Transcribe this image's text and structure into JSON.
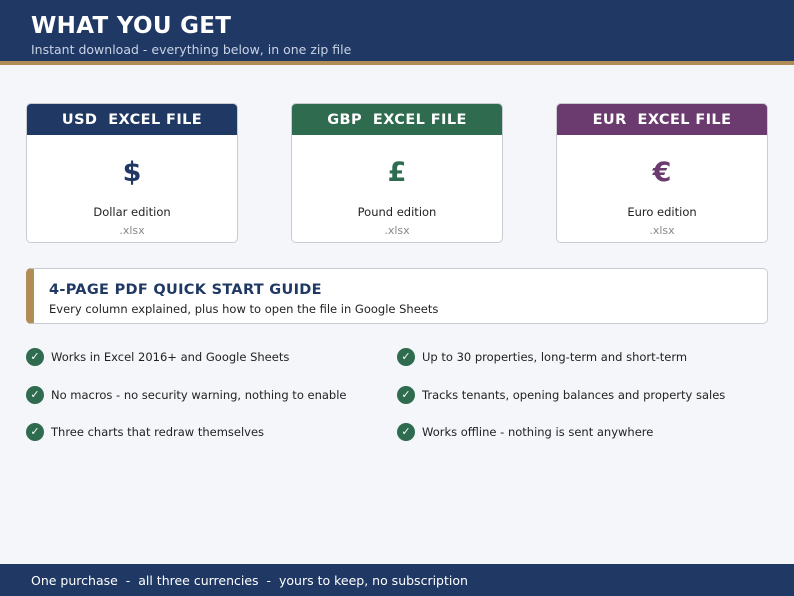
{
  "header": {
    "title": "WHAT YOU GET",
    "subtitle": "Instant download  -  everything below, in one zip file"
  },
  "cards": [
    {
      "title": "USD  EXCEL FILE",
      "symbol": "$",
      "edition": "Dollar edition",
      "ext": ".xlsx",
      "color": "#1f3864"
    },
    {
      "title": "GBP  EXCEL FILE",
      "symbol": "£",
      "edition": "Pound edition",
      "ext": ".xlsx",
      "color": "#2f6b4e"
    },
    {
      "title": "EUR  EXCEL FILE",
      "symbol": "€",
      "edition": "Euro edition",
      "ext": ".xlsx",
      "color": "#6b3a6e"
    }
  ],
  "guide": {
    "title": "4-PAGE PDF QUICK START GUIDE",
    "subtitle": "Every column explained, plus how to open the file in Google Sheets",
    "accent": "#b08d57"
  },
  "features": [
    "Works in Excel 2016+ and Google Sheets",
    "Up to 30 properties, long-term and short-term",
    "No macros - no security warning, nothing to enable",
    "Tracks tenants, opening balances and property sales",
    "Three charts that redraw themselves",
    "Works offline - nothing is sent anywhere"
  ],
  "check_glyph": "✓",
  "footer": {
    "text": "One purchase  -  all three currencies  -  yours to keep, no subscription"
  }
}
